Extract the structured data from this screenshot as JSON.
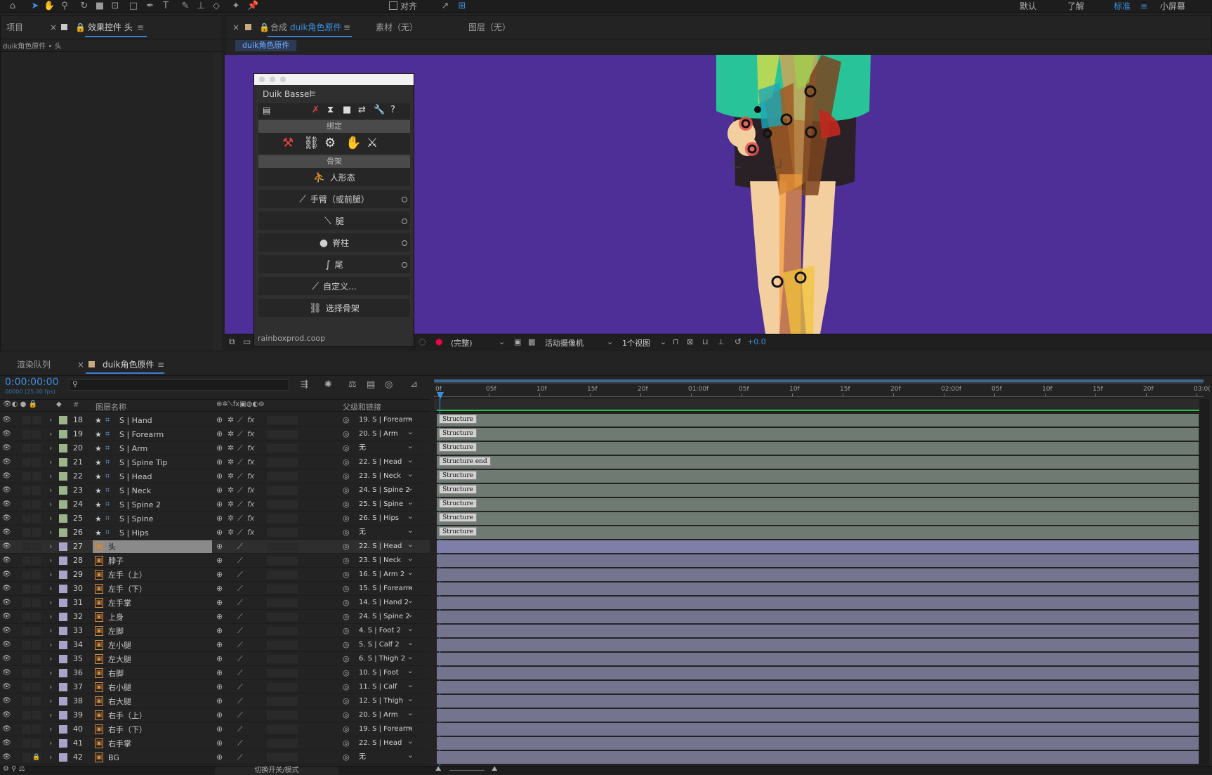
{
  "workspaces": [
    {
      "label": "默认",
      "active": false
    },
    {
      "label": "了解",
      "active": false
    },
    {
      "label": "标准",
      "active": true
    },
    {
      "label": "小屏幕",
      "active": false
    }
  ],
  "toolbar": {
    "align_label": "对齐",
    "menu_glyph": "≡"
  },
  "left_panel": {
    "tab_project": "项目",
    "tab_effects": "效果控件 头",
    "breadcrumb": "duik角色原件 • 头"
  },
  "viewer_panel": {
    "tab_comp_prefix": "合成",
    "tab_comp_name": "duik角色原件",
    "tab_footage": "素材（无）",
    "tab_layer": "图层（无）",
    "comp_chip": "duik角色原件",
    "quality": "(完整)",
    "camera": "活动摄像机",
    "views": "1个视图",
    "exposure": "+0.0"
  },
  "duik": {
    "title": "Duik Bassel",
    "menu": "≡",
    "section_rig": "绑定",
    "section_bones": "骨架",
    "items": [
      {
        "label": "人形态",
        "icon": "human-icon",
        "has_option": false
      },
      {
        "label": "手臂（或前腿）",
        "icon": "arm-icon",
        "has_option": true
      },
      {
        "label": "腿",
        "icon": "leg-icon",
        "has_option": true
      },
      {
        "label": "脊柱",
        "icon": "spine-icon",
        "has_option": true
      },
      {
        "label": "尾",
        "icon": "tail-icon",
        "has_option": true
      },
      {
        "label": "自定义...",
        "icon": "custom-bone-icon",
        "has_option": false
      },
      {
        "label": "选择骨架",
        "icon": "select-bones-icon",
        "has_option": false
      }
    ],
    "footer": "rainboxprod.coop"
  },
  "timeline": {
    "tab_render": "渲染队列",
    "tab_comp": "duik角色原件",
    "timecode": "0:00:00:00",
    "fps": "00000 (25.00 fps)",
    "search_placeholder": "",
    "col_num": "#",
    "col_name": "图层名称",
    "col_parent": "父级和链接",
    "toggle_label": "切换开关/模式",
    "ruler": [
      {
        "t": "0f",
        "f": 0
      },
      {
        "t": "05f",
        "f": 0.2
      },
      {
        "t": "10f",
        "f": 0.4
      },
      {
        "t": "15f",
        "f": 0.6
      },
      {
        "t": "20f",
        "f": 0.8
      },
      {
        "t": "01:00f",
        "f": 1
      },
      {
        "t": "05f",
        "f": 1.2
      },
      {
        "t": "10f",
        "f": 1.4
      },
      {
        "t": "15f",
        "f": 1.6
      },
      {
        "t": "20f",
        "f": 1.8
      },
      {
        "t": "02:00f",
        "f": 2
      },
      {
        "t": "05f",
        "f": 2.2
      },
      {
        "t": "10f",
        "f": 2.4
      },
      {
        "t": "15f",
        "f": 2.6
      },
      {
        "t": "20f",
        "f": 2.8
      },
      {
        "t": "03:0(",
        "f": 3
      }
    ],
    "layers": [
      {
        "num": "18",
        "name": "S | Hand",
        "kind": "shape",
        "parent": "19. S | Forearm",
        "bar": "Structure"
      },
      {
        "num": "19",
        "name": "S | Forearm",
        "kind": "shape",
        "parent": "20. S | Arm",
        "bar": "Structure"
      },
      {
        "num": "20",
        "name": "S | Arm",
        "kind": "shape",
        "parent": "无",
        "bar": "Structure"
      },
      {
        "num": "21",
        "name": "S | Spine Tip",
        "kind": "shape",
        "parent": "22. S | Head",
        "bar": "Structure end"
      },
      {
        "num": "22",
        "name": "S | Head",
        "kind": "shape",
        "parent": "23. S | Neck",
        "bar": "Structure"
      },
      {
        "num": "23",
        "name": "S | Neck",
        "kind": "shape",
        "parent": "24. S | Spine 2",
        "bar": "Structure"
      },
      {
        "num": "24",
        "name": "S | Spine 2",
        "kind": "shape",
        "parent": "25. S | Spine",
        "bar": "Structure"
      },
      {
        "num": "25",
        "name": "S | Spine",
        "kind": "shape",
        "parent": "26. S | Hips",
        "bar": "Structure"
      },
      {
        "num": "26",
        "name": "S | Hips",
        "kind": "shape",
        "parent": "无",
        "bar": "Structure"
      },
      {
        "num": "27",
        "name": "头",
        "kind": "image",
        "parent": "22. S | Head",
        "bar": "",
        "selected": true
      },
      {
        "num": "28",
        "name": "脖子",
        "kind": "image",
        "parent": "23. S | Neck",
        "bar": ""
      },
      {
        "num": "29",
        "name": "左手（上）",
        "kind": "image",
        "parent": "16. S | Arm 2",
        "bar": ""
      },
      {
        "num": "30",
        "name": "左手（下）",
        "kind": "image",
        "parent": "15. S | Forearm",
        "bar": ""
      },
      {
        "num": "31",
        "name": "左手掌",
        "kind": "image",
        "parent": "14. S | Hand 2",
        "bar": ""
      },
      {
        "num": "32",
        "name": "上身",
        "kind": "image",
        "parent": "24. S | Spine 2",
        "bar": ""
      },
      {
        "num": "33",
        "name": "左脚",
        "kind": "image",
        "parent": "4. S | Foot 2",
        "bar": ""
      },
      {
        "num": "34",
        "name": "左小腿",
        "kind": "image",
        "parent": "5. S | Calf 2",
        "bar": ""
      },
      {
        "num": "35",
        "name": "左大腿",
        "kind": "image",
        "parent": "6. S | Thigh 2",
        "bar": ""
      },
      {
        "num": "36",
        "name": "右脚",
        "kind": "image",
        "parent": "10. S | Foot",
        "bar": ""
      },
      {
        "num": "37",
        "name": "右小腿",
        "kind": "image",
        "parent": "11. S | Calf",
        "bar": ""
      },
      {
        "num": "38",
        "name": "右大腿",
        "kind": "image",
        "parent": "12. S | Thigh",
        "bar": ""
      },
      {
        "num": "39",
        "name": "右手（上）",
        "kind": "image",
        "parent": "20. S | Arm",
        "bar": ""
      },
      {
        "num": "40",
        "name": "右手（下）",
        "kind": "image",
        "parent": "19. S | Forearm",
        "bar": ""
      },
      {
        "num": "41",
        "name": "右手掌",
        "kind": "image",
        "parent": "22. S | Head",
        "bar": ""
      },
      {
        "num": "42",
        "name": "BG",
        "kind": "image",
        "parent": "无",
        "bar": "",
        "locked": true
      }
    ]
  },
  "colors": {
    "accent": "#3a8fe0",
    "viewer_bg": "#4e2e97",
    "structure_bar": "#6f7a72",
    "image_bar": "#74748f",
    "label_green": "#9bb58b",
    "label_lavender": "#a8a3c8"
  }
}
